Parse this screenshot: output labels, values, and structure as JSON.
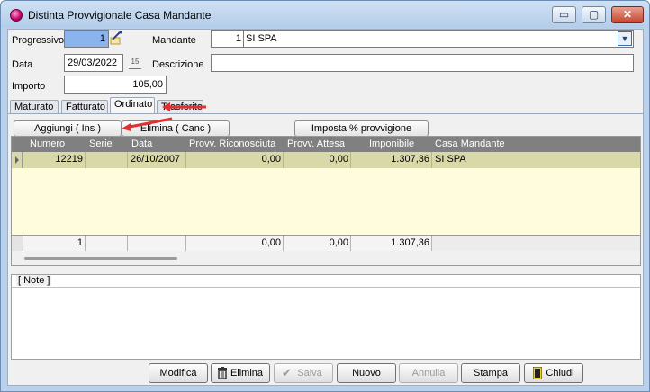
{
  "window": {
    "title": "Distinta Provvigionale Casa Mandante",
    "controls": {
      "minimize": "▭",
      "maximize": "▢",
      "close": "✕"
    }
  },
  "form": {
    "progressivo_label": "Progressivo",
    "progressivo_value": "1",
    "mandante_label": "Mandante",
    "mandante_code": "1",
    "mandante_name": "SI            SPA",
    "data_label": "Data",
    "data_value": "29/03/2022",
    "calendar_icon_text": "15",
    "descrizione_label": "Descrizione",
    "descrizione_value": "",
    "importo_label": "Importo",
    "importo_value": "105,00"
  },
  "tabs": [
    {
      "label": "Maturato"
    },
    {
      "label": "Fatturato"
    },
    {
      "label": "Ordinato"
    },
    {
      "label": "Trasferito"
    }
  ],
  "toolbar": {
    "aggiungi": "Aggiungi ( Ins )",
    "elimina": "Elimina ( Canc )",
    "imposta": "Imposta % provvigione"
  },
  "grid": {
    "columns": [
      "Numero",
      "Serie",
      "Data",
      "Provv. Riconosciuta",
      "Provv. Attesa",
      "Imponibile",
      "Casa Mandante"
    ],
    "rows": [
      {
        "numero": "12219",
        "serie": "",
        "data": "26/10/2007",
        "provv_riconosciuta": "0,00",
        "provv_attesa": "0,00",
        "imponibile": "1.307,36",
        "casa_mandante": "SI            SPA"
      }
    ],
    "totals": {
      "numero": "1",
      "serie": "",
      "data": "",
      "provv_riconosciuta": "0,00",
      "provv_attesa": "0,00",
      "imponibile": "1.307,36"
    }
  },
  "notes": {
    "label": "[ Note ]",
    "value": ""
  },
  "bottom": {
    "modifica": "Modifica",
    "elimina": "Elimina",
    "salva": "Salva",
    "nuovo": "Nuovo",
    "annulla": "Annulla",
    "stampa": "Stampa",
    "chiudi": "Chiudi"
  },
  "colors": {
    "accent_field": "#8cb4ec",
    "grid_row_selected": "#d8d8a8",
    "grid_body": "#fefcdc",
    "annotation_arrow": "#e03030"
  }
}
